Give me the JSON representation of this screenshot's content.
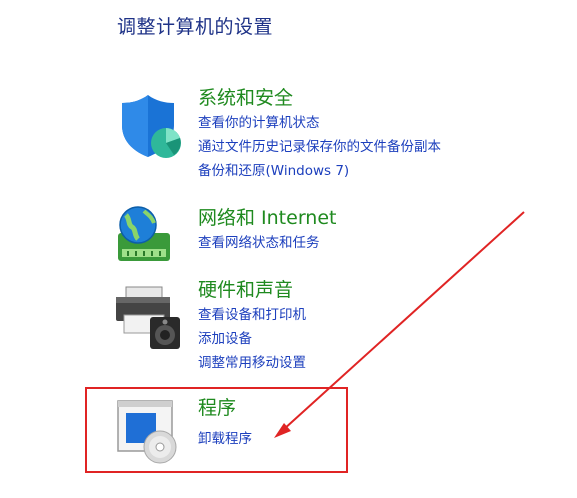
{
  "header": {
    "title": "调整计算机的设置"
  },
  "categories": [
    {
      "title": "系统和安全",
      "icon": "shield-icon",
      "links": [
        "查看你的计算机状态",
        "通过文件历史记录保存你的文件备份副本",
        "备份和还原(Windows 7)"
      ]
    },
    {
      "title": "网络和 Internet",
      "icon": "network-globe-icon",
      "links": [
        "查看网络状态和任务"
      ]
    },
    {
      "title": "硬件和声音",
      "icon": "printer-speaker-icon",
      "links": [
        "查看设备和打印机",
        "添加设备",
        "调整常用移动设置"
      ]
    },
    {
      "title": "程序",
      "icon": "programs-disc-icon",
      "links": [
        "卸载程序"
      ]
    }
  ],
  "colors": {
    "title_blue": "#1e3287",
    "category_green": "#1f8a1f",
    "link_blue": "#1c3fbd",
    "annotation_red": "#e02424"
  }
}
